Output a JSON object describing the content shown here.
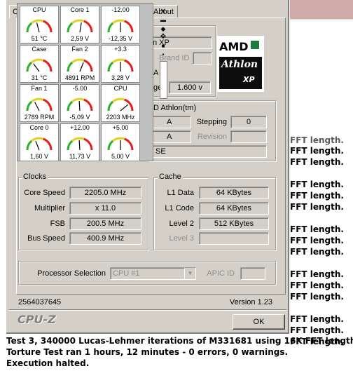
{
  "log": {
    "right_lines": [
      {
        "text": "FFT length.",
        "dim": true
      },
      {
        "text": "FFT length."
      },
      {
        "text": "FFT length."
      },
      {
        "text": "FFT length."
      },
      {
        "text": "FFT length."
      },
      {
        "text": "FFT length."
      },
      {
        "text": "FFT length."
      },
      {
        "text": "FFT length."
      },
      {
        "text": "FFT length."
      },
      {
        "text": "FFT length."
      },
      {
        "text": "FFT length."
      },
      {
        "text": "FFT length."
      },
      {
        "text": "FFT length."
      },
      {
        "text": "FFT length."
      },
      {
        "text": "FFT length."
      }
    ],
    "bottom_line_1": "Test 3, 340000 Lucas-Lehmer iterations of M331681 using 16K FFT length.",
    "bottom_line_2": "Torture Test ran 1 hours, 12 minutes - 0 errors, 0 warnings.",
    "bottom_line_3": "Execution halted."
  },
  "cpuz": {
    "tabs": {
      "first": "C",
      "about": "About"
    },
    "cpu": {
      "name_partial": "n XP",
      "brand_id_label": "Brand ID",
      "row3_partial": "A",
      "voltage_label_partial": "ge",
      "voltage_value": "1.600 v",
      "spec_partial": "D Athlon(tm)",
      "family_partial": "A",
      "ext_partial": "A",
      "stepping_label": "Stepping",
      "stepping_value": "0",
      "revision_label": "Revision",
      "instr_partial": "SE"
    },
    "logo": {
      "brand": "AMD",
      "product": "Athlon",
      "suffix": "XP"
    },
    "clocks": {
      "title": "Clocks",
      "core_speed_label": "Core Speed",
      "core_speed": "2205.0 MHz",
      "multiplier_label": "Multiplier",
      "multiplier": "x 11.0",
      "fsb_label": "FSB",
      "fsb": "200.5 MHz",
      "bus_speed_label": "Bus Speed",
      "bus_speed": "400.9 MHz"
    },
    "cache": {
      "title": "Cache",
      "l1_data_label": "L1 Data",
      "l1_data": "64 KBytes",
      "l1_code_label": "L1 Code",
      "l1_code": "64 KBytes",
      "level2_label": "Level 2",
      "level2": "512 KBytes",
      "level3_label": "Level 3",
      "level3": ""
    },
    "processor_selection_label": "Processor Selection",
    "processor_selection_value": "CPU #1",
    "apic_id_label": "APIC ID",
    "apic_id_value": "",
    "serial": "2564037645",
    "version": "Version 1.23",
    "brand": "CPU-Z",
    "ok_label": "OK"
  },
  "gauges": [
    {
      "title": "CPU",
      "value": "51 °C",
      "level": 0.42
    },
    {
      "title": "Core 1",
      "value": "2,59 V",
      "level": 0.55
    },
    {
      "title": "-12.00",
      "value": "-12,35 V",
      "level": 0.5
    },
    {
      "title": "Case",
      "value": "31 °C",
      "level": 0.3
    },
    {
      "title": "Fan 2",
      "value": "4891 RPM",
      "level": 0.62
    },
    {
      "title": "+3.3",
      "value": "3,28 V",
      "level": 0.5
    },
    {
      "title": "Fan 1",
      "value": "2789 RPM",
      "level": 0.35
    },
    {
      "title": "-5.00",
      "value": "-5,09 V",
      "level": 0.48
    },
    {
      "title": "CPU",
      "value": "2203 MHz",
      "level": 0.78
    },
    {
      "title": "Core 0",
      "value": "1,60 V",
      "level": 0.38
    },
    {
      "title": "+12.00",
      "value": "11,73 V",
      "level": 0.48
    },
    {
      "title": "+5.00",
      "value": "5,00 V",
      "level": 0.5
    }
  ],
  "colors": {
    "gauge_green": "#2bb32b",
    "gauge_yellow": "#e3d21f",
    "gauge_red": "#e02020",
    "log_header": "#d0a9a9"
  }
}
